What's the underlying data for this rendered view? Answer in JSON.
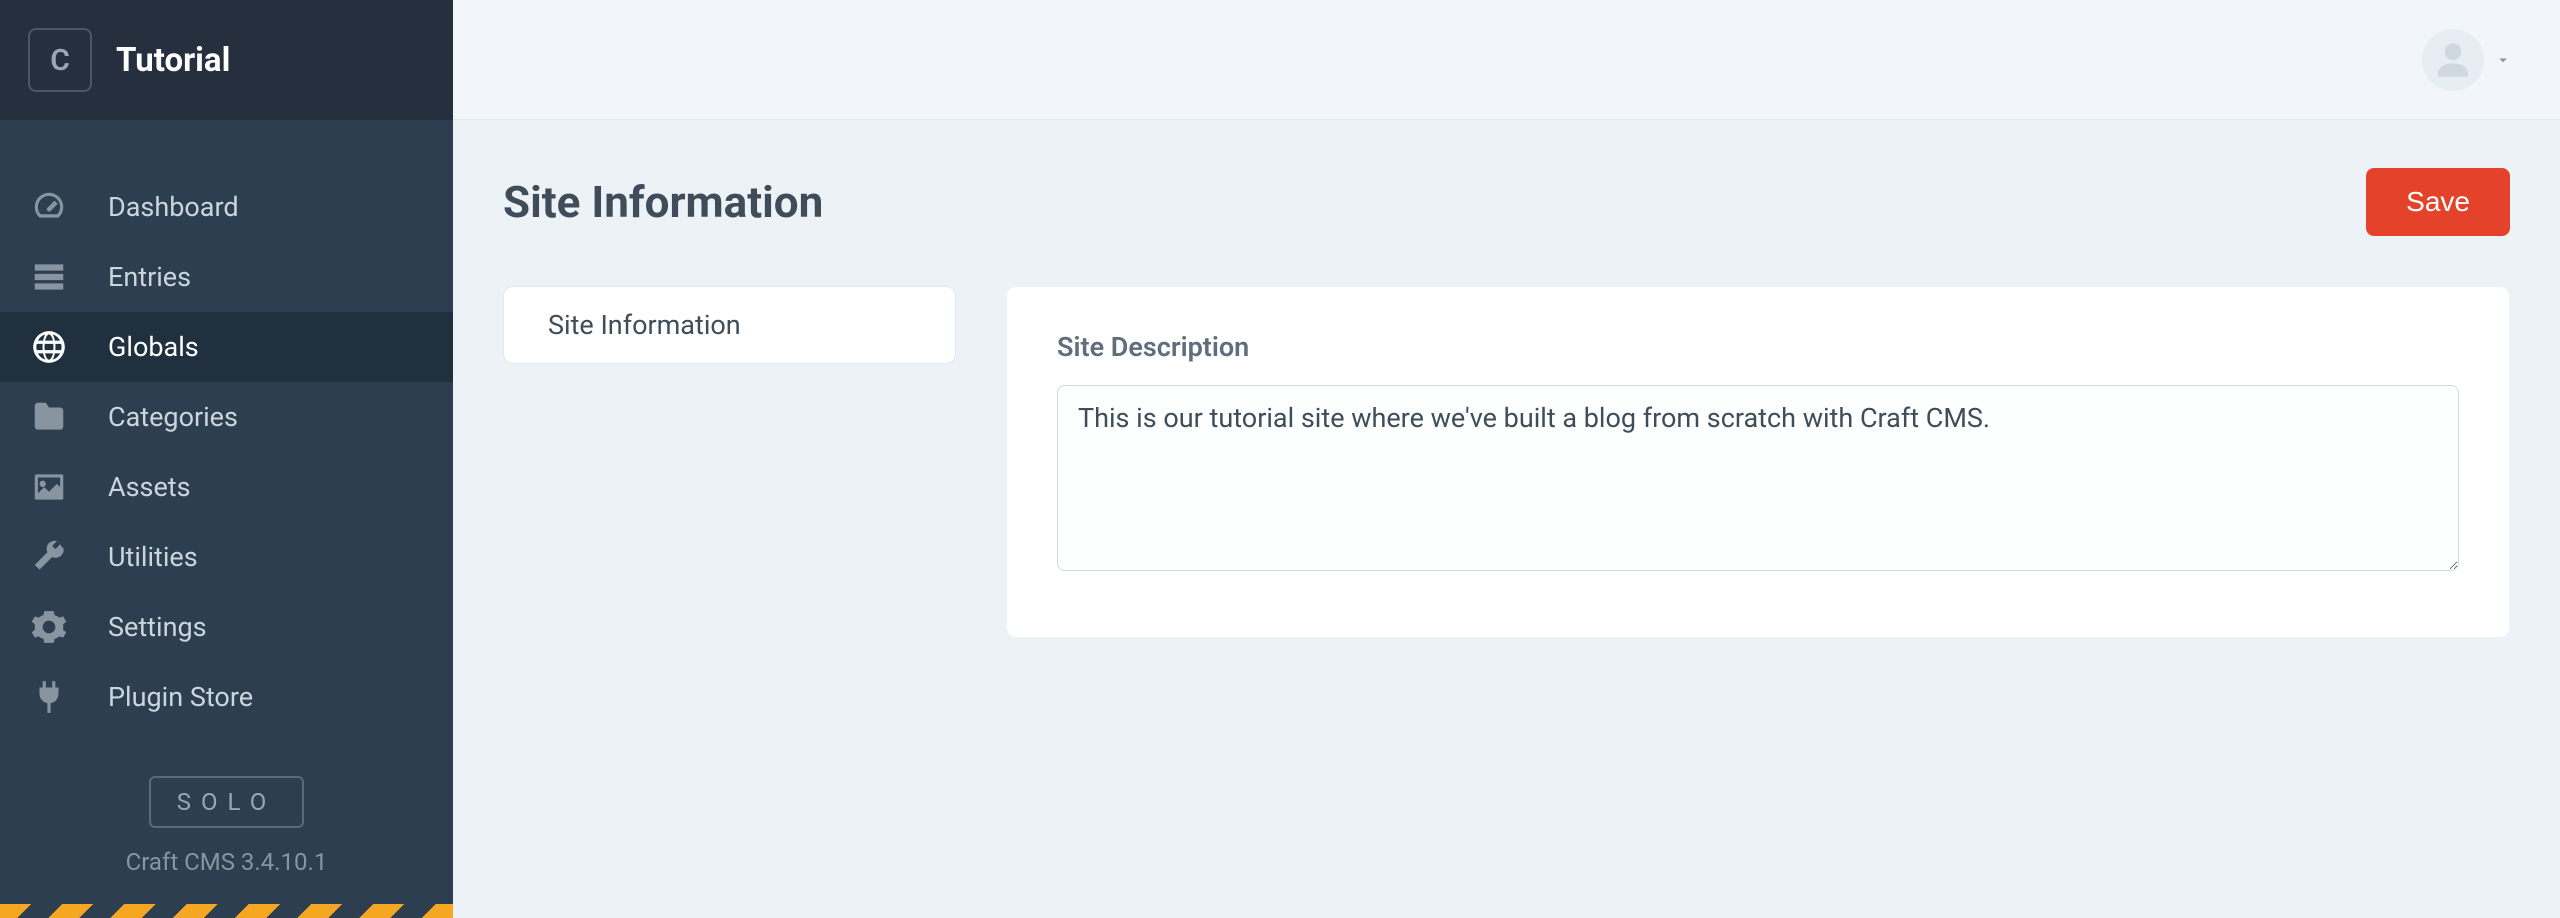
{
  "sidebar": {
    "logo_letter": "C",
    "site_name": "Tutorial",
    "nav": [
      {
        "label": "Dashboard"
      },
      {
        "label": "Entries"
      },
      {
        "label": "Globals"
      },
      {
        "label": "Categories"
      },
      {
        "label": "Assets"
      },
      {
        "label": "Utilities"
      },
      {
        "label": "Settings"
      },
      {
        "label": "Plugin Store"
      }
    ],
    "edition_badge": "SOLO",
    "version": "Craft CMS 3.4.10.1"
  },
  "page": {
    "title": "Site Information",
    "save_label": "Save",
    "tabs": [
      {
        "label": "Site Information"
      }
    ],
    "fields": {
      "site_description": {
        "label": "Site Description",
        "value": "This is our tutorial site where we've built a blog from scratch with Craft CMS."
      }
    }
  }
}
